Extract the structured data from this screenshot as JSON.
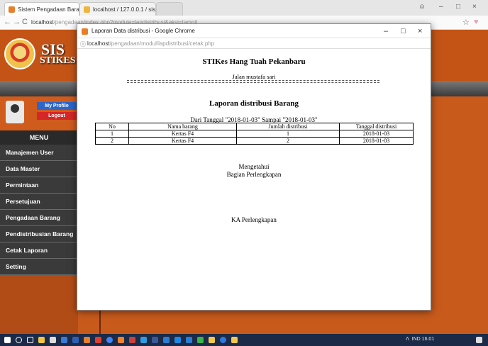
{
  "browser": {
    "tabs": [
      {
        "label": "Sistem Pengadaan Baran",
        "close": "×"
      },
      {
        "label": "localhost / 127.0.0.1 / sis",
        "close": "×"
      }
    ],
    "address": {
      "host": "localhost",
      "path": "/pengadaan/index.php?module=lapdistribusi&aksi=tampil"
    },
    "controls": {
      "minimize": "–",
      "maximize": "□",
      "close": "×",
      "back": "←",
      "forward": "→",
      "reload": "C",
      "star": "☆"
    }
  },
  "app": {
    "brand": "SIS",
    "brand_sub": "STIKES",
    "profile": {
      "my_profile": "My Profile",
      "logout": "Logout"
    },
    "menu_title": "MENU",
    "menu": [
      "Manajemen User",
      "Data Master",
      "Permintaan",
      "Persetujuan",
      "Pengadaan Barang",
      "Pendistribusian Barang",
      "Cetak Laporan",
      "Setting"
    ]
  },
  "popup": {
    "title": "Laporan Data distribusi - Google Chrome",
    "address": {
      "host": "localhost",
      "path": "/pengadaan/modul/lapdistribusi/cetak.php"
    },
    "controls": {
      "minimize": "–",
      "maximize": "□",
      "close": "×"
    }
  },
  "report": {
    "org": "STIKes Hang Tuah Pekanbaru",
    "address": "Jalan mustafa sari",
    "title": "Laporan distribusi Barang",
    "period": "Dari Tanggal \"2018-01-03\" Sampai \"2018-01-03\"",
    "columns": [
      "No",
      "Nama barang",
      "Jumlah distribusi",
      "Tanggal distribusi"
    ],
    "rows": [
      [
        "1",
        "Kertas F4",
        "1",
        "2018-01-03"
      ],
      [
        "2",
        "Kertas F4",
        "2",
        "2018-01-03"
      ]
    ],
    "ack_line1": "Mengetahui",
    "ack_line2": "Bagian Perlengkapan",
    "signature": "KA Perlengkapan"
  },
  "taskbar": {
    "tray_text": "ᐱ  ⁠  IND  16.01"
  }
}
